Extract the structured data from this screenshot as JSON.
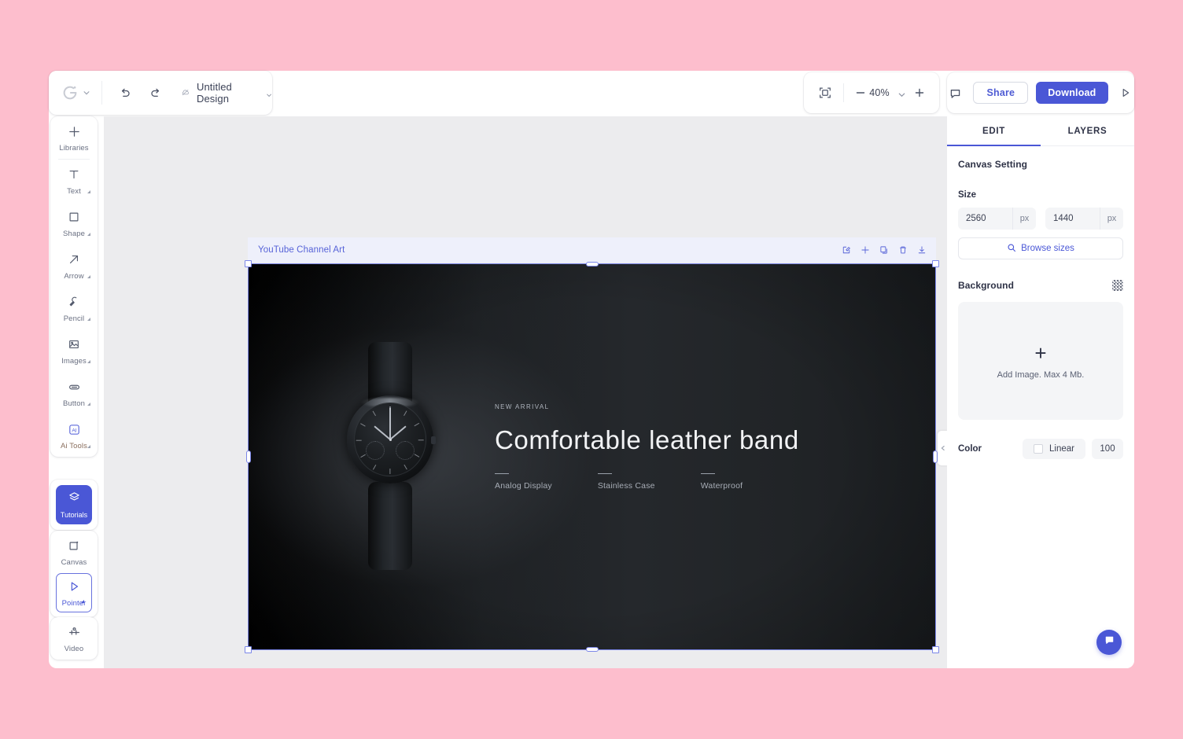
{
  "app": {
    "background_color": "#fdbecd",
    "accent_color": "#4a57d6"
  },
  "topbar": {
    "logo_name": "brand-logo",
    "logo_chevron": "chevron-down-icon",
    "undo_label": "Undo",
    "redo_label": "Redo",
    "doc_title": "Untitled Design",
    "doc_chevron": "chevron-down-icon",
    "fit_label": "Fit to screen",
    "zoom_minus": "−",
    "zoom_value": "40%",
    "zoom_plus": "+",
    "comment_label": "Comments",
    "share_label": "Share",
    "download_label": "Download",
    "present_label": "Present"
  },
  "left_toolbar": {
    "items": [
      {
        "label": "Libraries",
        "icon": "plus-icon",
        "has_corner": false
      },
      {
        "label": "Text",
        "icon": "text-icon",
        "has_corner": true
      },
      {
        "label": "Shape",
        "icon": "square-icon",
        "has_corner": true
      },
      {
        "label": "Arrow",
        "icon": "arrow-icon",
        "has_corner": true
      },
      {
        "label": "Pencil",
        "icon": "pencil-icon",
        "has_corner": true
      },
      {
        "label": "Images",
        "icon": "image-icon",
        "has_corner": true
      },
      {
        "label": "Button",
        "icon": "button-icon",
        "has_corner": true
      },
      {
        "label": "Ai Tools",
        "icon": "ai-icon",
        "has_corner": true
      }
    ],
    "tutorials": {
      "label": "Tutorials",
      "icon": "layers-icon",
      "active": true
    },
    "canvas": {
      "label": "Canvas",
      "icon": "canvas-icon"
    },
    "pointer": {
      "label": "Pointer",
      "icon": "pointer-icon",
      "active": true
    },
    "video": {
      "label": "Video",
      "icon": "video-icon"
    }
  },
  "artboard": {
    "name": "YouTube Channel Art",
    "tools": [
      {
        "name": "edit-icon",
        "label": "Edit"
      },
      {
        "name": "add-icon",
        "label": "Add"
      },
      {
        "name": "duplicate-icon",
        "label": "Duplicate"
      },
      {
        "name": "delete-icon",
        "label": "Delete"
      },
      {
        "name": "download-icon",
        "label": "Download"
      }
    ],
    "design": {
      "kicker": "NEW ARRIVAL",
      "headline": "Comfortable leather band",
      "features": [
        "Analog Display",
        "Stainless Case",
        "Waterproof"
      ],
      "product": "wristwatch-with-leather-band"
    }
  },
  "right_panel": {
    "tabs": [
      {
        "label": "EDIT",
        "active": true
      },
      {
        "label": "LAYERS",
        "active": false
      }
    ],
    "canvas_setting": {
      "title": "Canvas Setting",
      "size_label": "Size",
      "width_value": "2560",
      "width_unit": "px",
      "height_value": "1440",
      "height_unit": "px",
      "browse_label": "Browse sizes"
    },
    "background": {
      "title": "Background",
      "transparency_icon": "checkerboard-icon",
      "dropzone_plus": "+",
      "dropzone_text": "Add Image. Max 4 Mb."
    },
    "color": {
      "label": "Color",
      "mode": "Linear",
      "opacity": "100"
    }
  },
  "help": {
    "label": "Help",
    "icon": "chat-icon"
  }
}
